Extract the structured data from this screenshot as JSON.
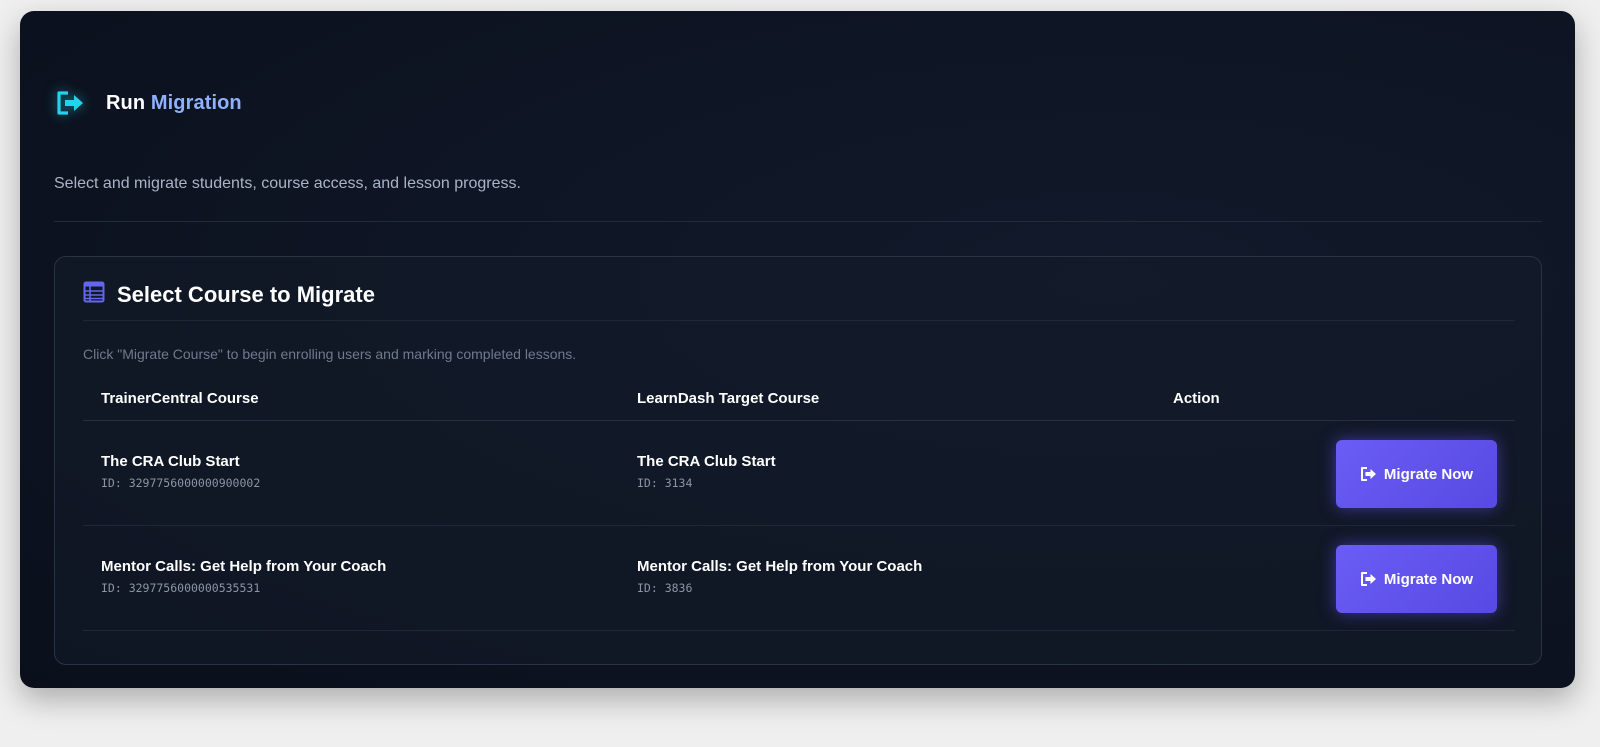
{
  "header": {
    "title_plain": "Run",
    "title_accent": "Migration",
    "icon": "sign-out-icon",
    "subtitle": "Select and migrate students, course access, and lesson progress."
  },
  "card": {
    "icon": "list-table-icon",
    "title": "Select Course to Migrate",
    "hint": "Click \"Migrate Course\" to begin enrolling users and marking completed lessons."
  },
  "table": {
    "columns": [
      "TrainerCentral Course",
      "LearnDash Target Course",
      "Action"
    ],
    "rows": [
      {
        "source_name": "The CRA Club Start",
        "source_id": "ID: 3297756000000900002",
        "target_name": "The CRA Club Start",
        "target_id": "ID: 3134",
        "action_label": "Migrate Now"
      },
      {
        "source_name": "Mentor Calls: Get Help from Your Coach",
        "source_id": "ID: 3297756000000535531",
        "target_name": "Mentor Calls: Get Help from Your Coach",
        "target_id": "ID: 3836",
        "action_label": "Migrate Now"
      }
    ]
  },
  "colors": {
    "accent_title": "#8fb0ff",
    "header_icon": "#22d3ee",
    "card_icon": "#6366f1",
    "button": "#5b4ff0"
  }
}
